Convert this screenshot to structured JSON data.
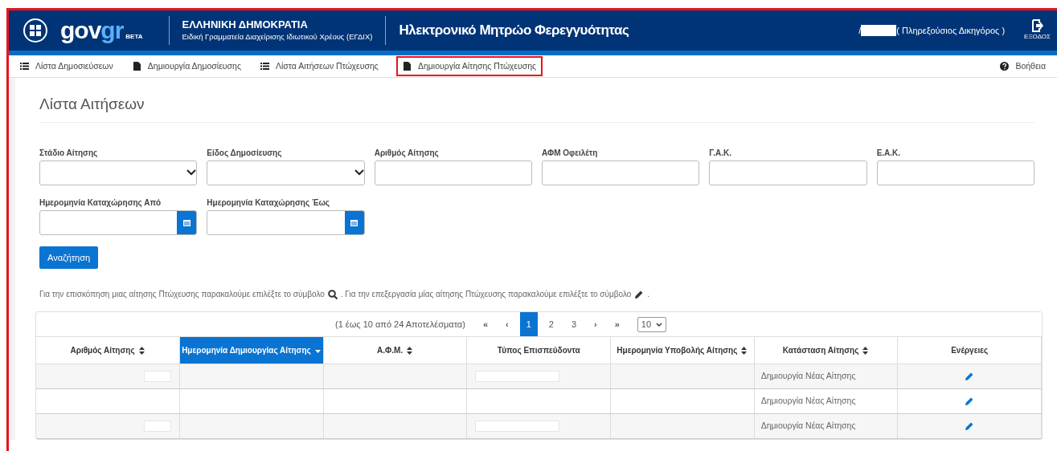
{
  "header": {
    "logo": {
      "word": "gov",
      "accent": "gr",
      "badge": "BETA"
    },
    "org_title": "ΕΛΛΗΝΙΚΗ ΔΗΜΟΚΡΑΤΙΑ",
    "org_subtitle": "Ειδική Γραμματεία Διαχείρισης Ιδιωτικού Χρέους (ΕΓΔΙΧ)",
    "app_title": "Ηλεκτρονικό Μητρώο Φερεγγυότητας",
    "user_prefix": "/",
    "user_redacted": true,
    "user_role": "( Πληρεξούσιος Δικηγόρος )",
    "logout": "ΕΞΟΔΟΣ"
  },
  "nav": {
    "items": [
      {
        "label": "Λίστα Δημοσιεύσεων",
        "kind": "list",
        "highlighted": false
      },
      {
        "label": "Δημιουργία Δημοσίευσης",
        "kind": "file",
        "highlighted": false
      },
      {
        "label": "Λίστα Αιτήσεων Πτώχευσης",
        "kind": "list",
        "highlighted": false
      },
      {
        "label": "Δημιουργία Αίτησης Πτώχευσης",
        "kind": "file",
        "highlighted": true
      }
    ],
    "help": "Βοήθεια"
  },
  "page_title": "Λίστα Αιτήσεων",
  "filters": [
    {
      "label": "Στάδιο Αίτησης",
      "kind": "select"
    },
    {
      "label": "Είδος Δημοσίευσης",
      "kind": "select"
    },
    {
      "label": "Αριθμός Αίτησης",
      "kind": "text"
    },
    {
      "label": "ΑΦΜ Οφειλέτη",
      "kind": "text"
    },
    {
      "label": "Γ.Α.Κ.",
      "kind": "text"
    },
    {
      "label": "Ε.Α.Κ.",
      "kind": "text"
    },
    {
      "label": "Ημερομηνία Καταχώρησης Από",
      "kind": "date"
    },
    {
      "label": "Ημερομηνία Καταχώρησης Έως",
      "kind": "date"
    }
  ],
  "search_button": "Αναζήτηση",
  "hint": {
    "view_text": "Για την επισκόπηση μιας αίτησης Πτώχευσης παρακαλούμε επιλέξτε το σύμβολο",
    "edit_text": ". Για την επεξεργασία μίας αίτησης Πτώχευσης παρακαλούμε επιλέξτε το σύμβολο",
    "end": "."
  },
  "table": {
    "summary": "(1 έως 10 από 24 Αποτελέσματα)",
    "pagination": [
      {
        "label": "«",
        "kind": "nav",
        "selected": false
      },
      {
        "label": "‹",
        "kind": "nav",
        "selected": false
      },
      {
        "label": "1",
        "kind": "page",
        "selected": true
      },
      {
        "label": "2",
        "kind": "page",
        "selected": false
      },
      {
        "label": "3",
        "kind": "page",
        "selected": false
      },
      {
        "label": "›",
        "kind": "nav",
        "selected": false
      },
      {
        "label": "»",
        "kind": "nav",
        "selected": false
      }
    ],
    "page_size": "10",
    "columns": [
      {
        "label": "Αριθμός Αίτησης",
        "sortable": true,
        "sorted": false,
        "selected": false
      },
      {
        "label": "Ημερομηνία Δημιουργίας Αίτησης",
        "sortable": true,
        "sorted": true,
        "selected": true
      },
      {
        "label": "Α.Φ.Μ.",
        "sortable": true,
        "sorted": false,
        "selected": false
      },
      {
        "label": "Τύπος Επισπεύδοντα",
        "sortable": false,
        "selected": false
      },
      {
        "label": "Ημερομηνία Υποβολής Αίτησης",
        "sortable": true,
        "sorted": false,
        "selected": false
      },
      {
        "label": "Κατάσταση Αίτησης",
        "sortable": true,
        "sorted": false,
        "selected": false
      },
      {
        "label": "Ενέργειες",
        "sortable": false,
        "selected": false
      }
    ],
    "rows": [
      {
        "number_redacted": true,
        "type_redacted": true,
        "status": "Δημιουργία Νέας Αίτησης"
      },
      {
        "number_redacted": false,
        "type_redacted": false,
        "status": "Δημιουργία Νέας Αίτησης"
      },
      {
        "number_redacted": true,
        "type_redacted": true,
        "status": "Δημιουργία Νέας Αίτησης"
      }
    ]
  }
}
